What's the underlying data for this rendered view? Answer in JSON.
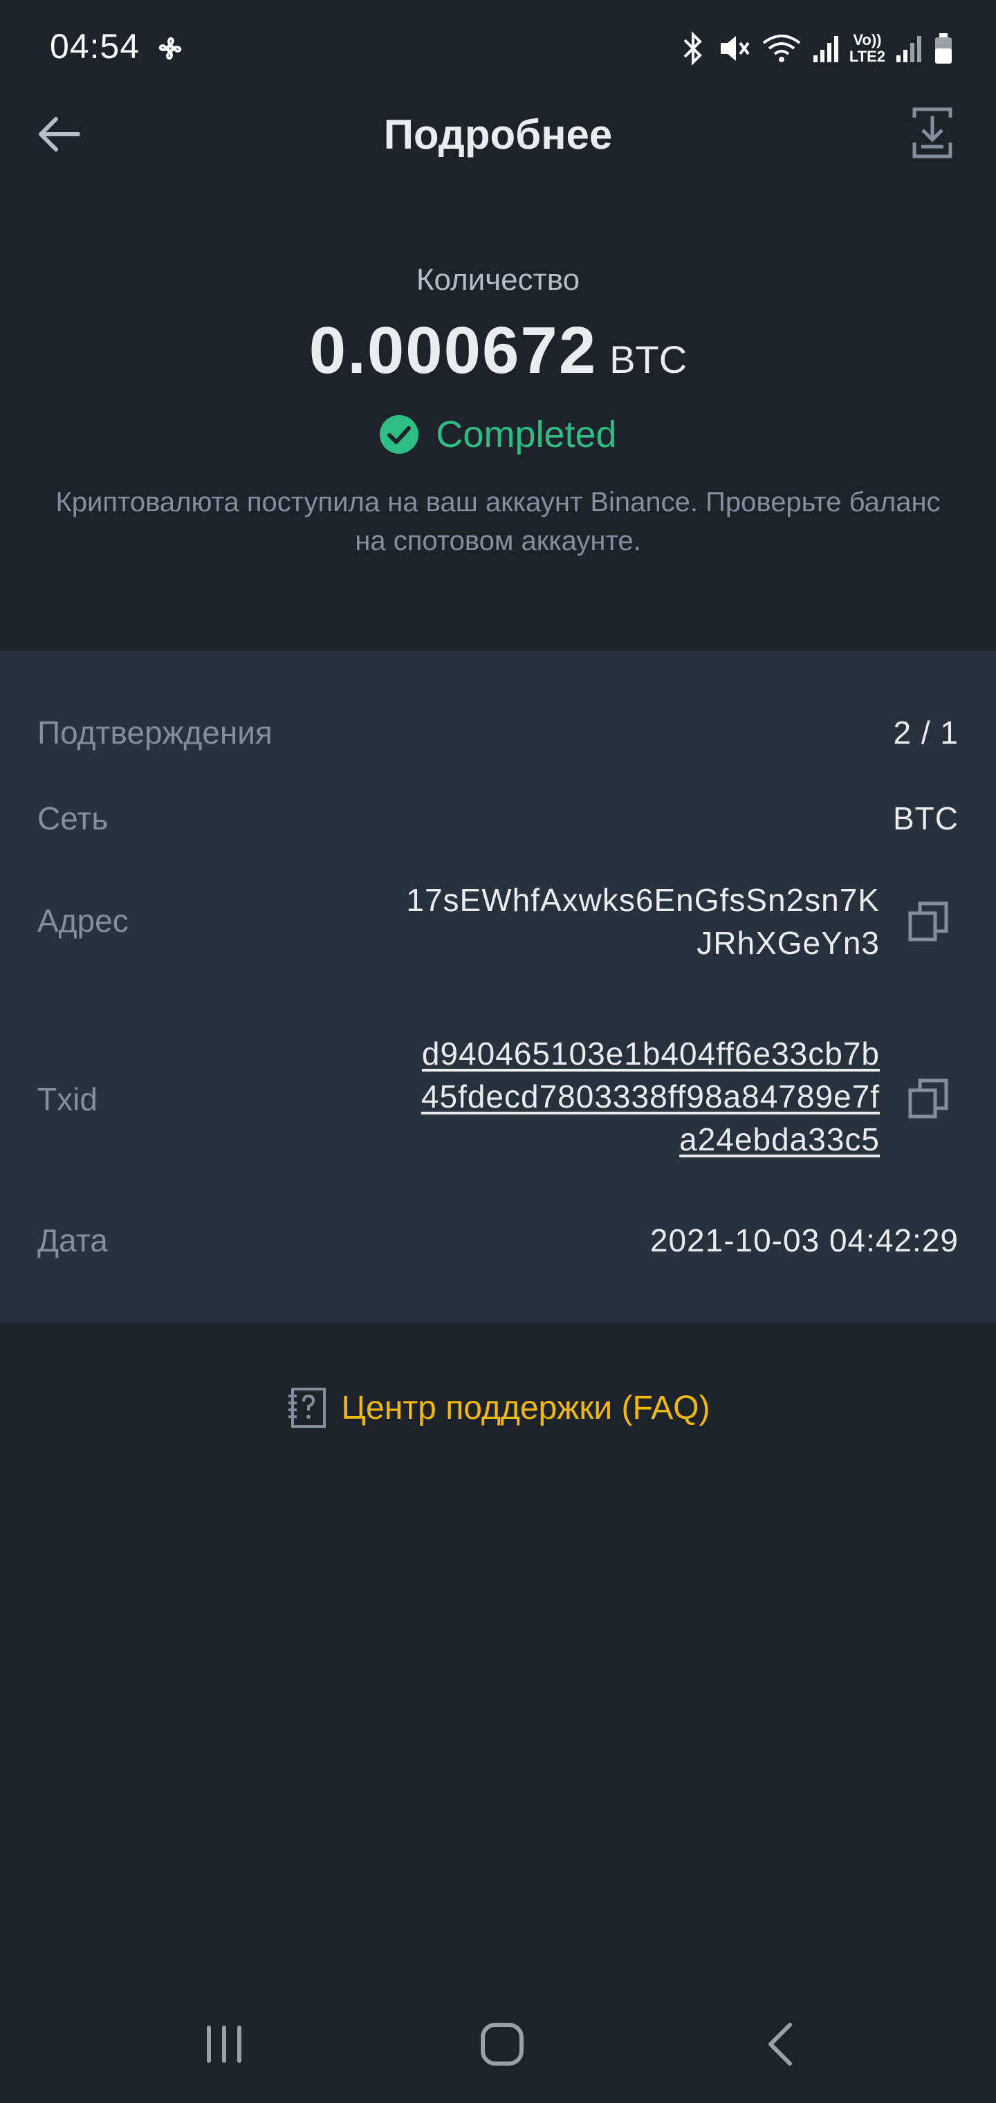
{
  "status_bar": {
    "time": "04:54",
    "network_label_top": "Vo))",
    "network_label_bottom": "LTE2"
  },
  "header": {
    "title": "Подробнее"
  },
  "summary": {
    "amount_label": "Количество",
    "amount": "0.000672",
    "currency": "BTC",
    "status": "Completed",
    "description": "Криптовалюта поступила на ваш аккаунт Binance. Проверьте баланс на спотовом аккаунте."
  },
  "details": {
    "confirmations": {
      "label": "Подтверждения",
      "value": "2 / 1"
    },
    "network": {
      "label": "Сеть",
      "value": "BTC"
    },
    "address": {
      "label": "Адрес",
      "value_line1": "17sEWhfAxwks6EnGfsSn2sn7K",
      "value_line2": "JRhXGeYn3"
    },
    "txid": {
      "label": "Txid",
      "value_line1": "d940465103e1b404ff6e33cb7b",
      "value_line2": "45fdecd7803338ff98a84789e7f",
      "value_line3": "a24ebda33c5"
    },
    "date": {
      "label": "Дата",
      "value": "2021-10-03 04:42:29"
    }
  },
  "faq": {
    "label": "Центр поддержки (FAQ)"
  },
  "colors": {
    "background": "#1e2329",
    "panel": "#29313d",
    "success": "#2ebd85",
    "accent": "#f0b90b",
    "muted": "#848e9c"
  },
  "icons": {
    "back": "arrow-left-icon",
    "download": "download-icon",
    "status": "check-circle-icon",
    "copy": "copy-icon",
    "faq": "help-document-icon",
    "nav_recent": "recent-apps-icon",
    "nav_home": "home-icon",
    "nav_back": "nav-back-icon"
  }
}
